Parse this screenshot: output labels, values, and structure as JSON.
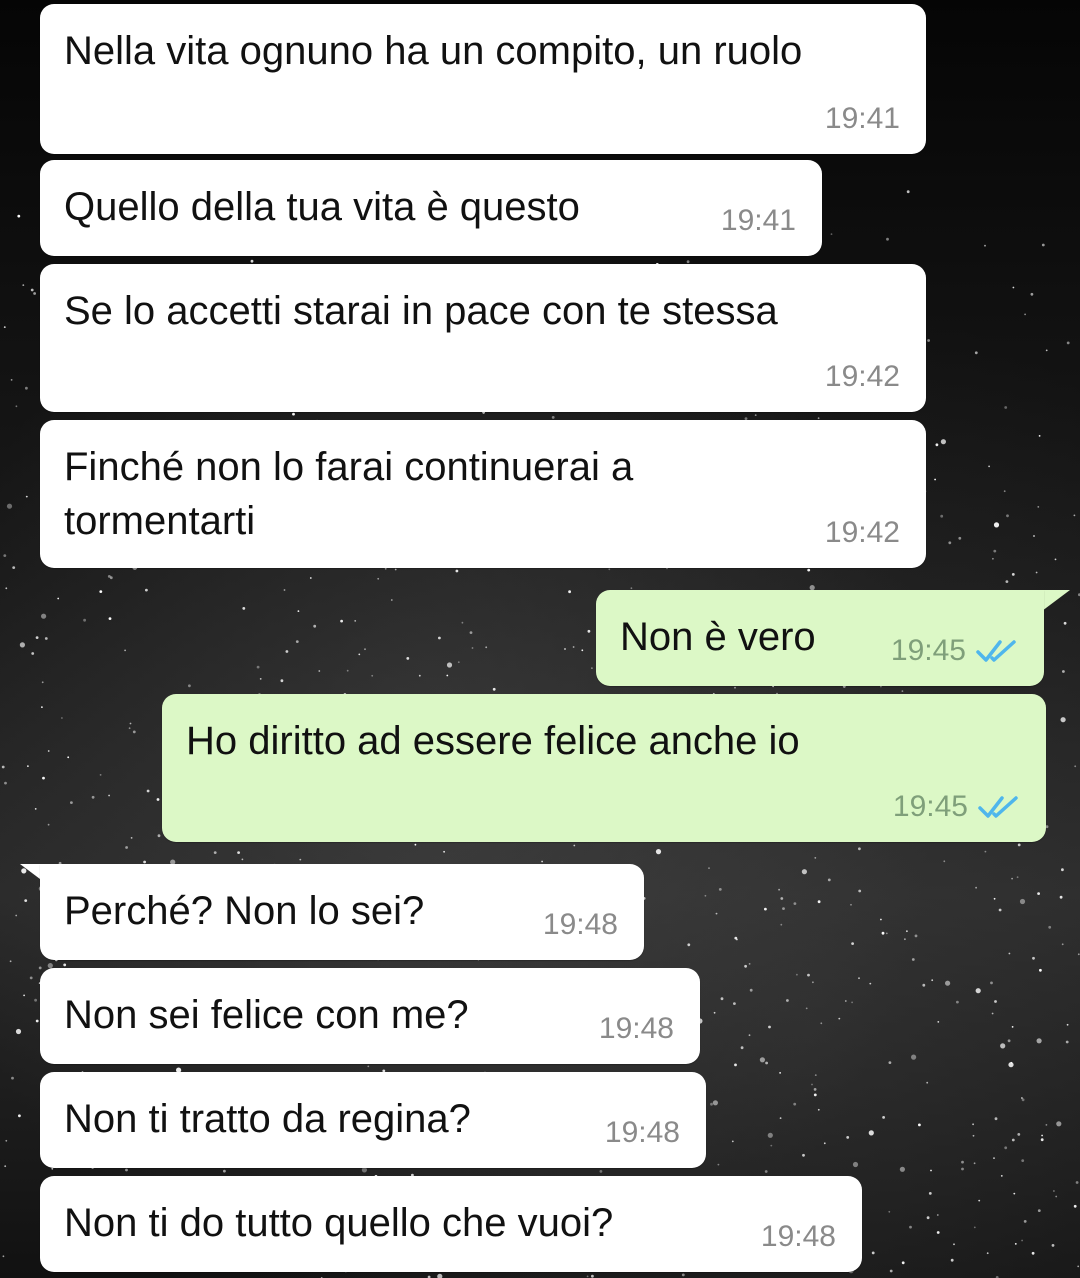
{
  "messages": [
    {
      "dir": "in",
      "text": "Nella vita ognuno ha un compito, un ruolo",
      "time": "19:41"
    },
    {
      "dir": "in",
      "text": "Quello della tua vita è questo",
      "time": "19:41"
    },
    {
      "dir": "in",
      "text": "Se lo accetti starai in pace con te stessa",
      "time": "19:42"
    },
    {
      "dir": "in",
      "text": "Finché non lo farai continuerai a\ntormentarti",
      "time": "19:42"
    },
    {
      "dir": "out",
      "text": "Non è vero",
      "time": "19:45",
      "status": "read"
    },
    {
      "dir": "out",
      "text": "Ho diritto ad essere felice anche io",
      "time": "19:45",
      "status": "read"
    },
    {
      "dir": "in",
      "text": "Perché? Non lo sei?",
      "time": "19:48"
    },
    {
      "dir": "in",
      "text": "Non sei felice con me?",
      "time": "19:48"
    },
    {
      "dir": "in",
      "text": "Non ti tratto da regina?",
      "time": "19:48"
    },
    {
      "dir": "in",
      "text": "Non ti do tutto quello che vuoi?",
      "time": "19:48"
    }
  ],
  "colors": {
    "incoming_bubble": "#ffffff",
    "outgoing_bubble": "#dcf8c6",
    "read_ticks": "#4fb6ec",
    "timestamp": "#8a8a8a"
  },
  "icons": {
    "read_receipt": "double-check-icon",
    "wallpaper": "night-city-wallpaper"
  }
}
